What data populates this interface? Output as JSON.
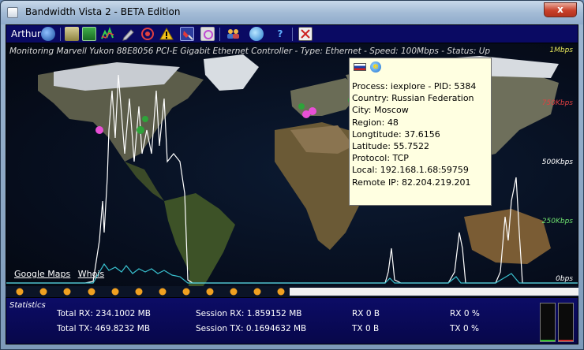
{
  "window": {
    "title": "Bandwidth Vista 2 - BETA Edition",
    "close_glyph": "x"
  },
  "toolbar": {
    "user": "Arthur",
    "icons": [
      "globe-icon",
      "network-cards-icon",
      "chip-icon",
      "graph-icon",
      "pencil-icon",
      "target-icon",
      "warning-icon",
      "pin-icon",
      "monitor-icon",
      "users-icon",
      "web-globe-icon",
      "help-icon",
      "exit-icon"
    ],
    "help_glyph": "?"
  },
  "status": "Monitoring Marvell Yukon 88E8056 PCI-E Gigabit Ethernet Controller - Type: Ethernet - Speed: 100Mbps - Status: Up",
  "scale": [
    "1Mbps",
    "750Kbps",
    "500Kbps",
    "250Kbps",
    "0bps"
  ],
  "scale_colors": [
    "#e6e65a",
    "#e04040",
    "#ffffff",
    "#6ee06e",
    "#ffffff"
  ],
  "links": {
    "maps": "Google Maps",
    "whois": "Whois"
  },
  "tooltip": {
    "flag": "russia-flag-icon",
    "app_icon": "internet-explorer-icon",
    "app_glyph": "e",
    "rows": [
      "Process: iexplore - PID: 5384",
      "Country: Russian Federation",
      "City: Moscow",
      "Region: 48",
      "Longtitude: 37.6156",
      "Latitude: 55.7522",
      "Protocol: TCP",
      "Local: 192.168.1.68:59759",
      "Remote IP: 82.204.219.201"
    ]
  },
  "stats": {
    "title": "Statistics",
    "total_rx": "Total RX: 234.1002 MB",
    "total_tx": "Total TX: 469.8232 MB",
    "session_rx": "Session RX: 1.859152 MB",
    "session_tx": "Session TX: 0.1694632 MB",
    "rx_bytes": "RX 0 B",
    "tx_bytes": "TX 0 B",
    "rx_pct": "RX 0 %",
    "tx_pct": "TX 0 %",
    "meters": [
      {
        "name": "rx-meter",
        "level": 0.02,
        "color": "#2fbf2f"
      },
      {
        "name": "tx-meter",
        "level": 0.02,
        "color": "#d22e2e"
      }
    ]
  },
  "colors": {
    "graph_rx": "#ffffff",
    "graph_tx": "#39c1cf",
    "pin_dot": "#e84fd6",
    "pin_green": "#2ea33a",
    "timeline_dot": "#f0a020"
  }
}
